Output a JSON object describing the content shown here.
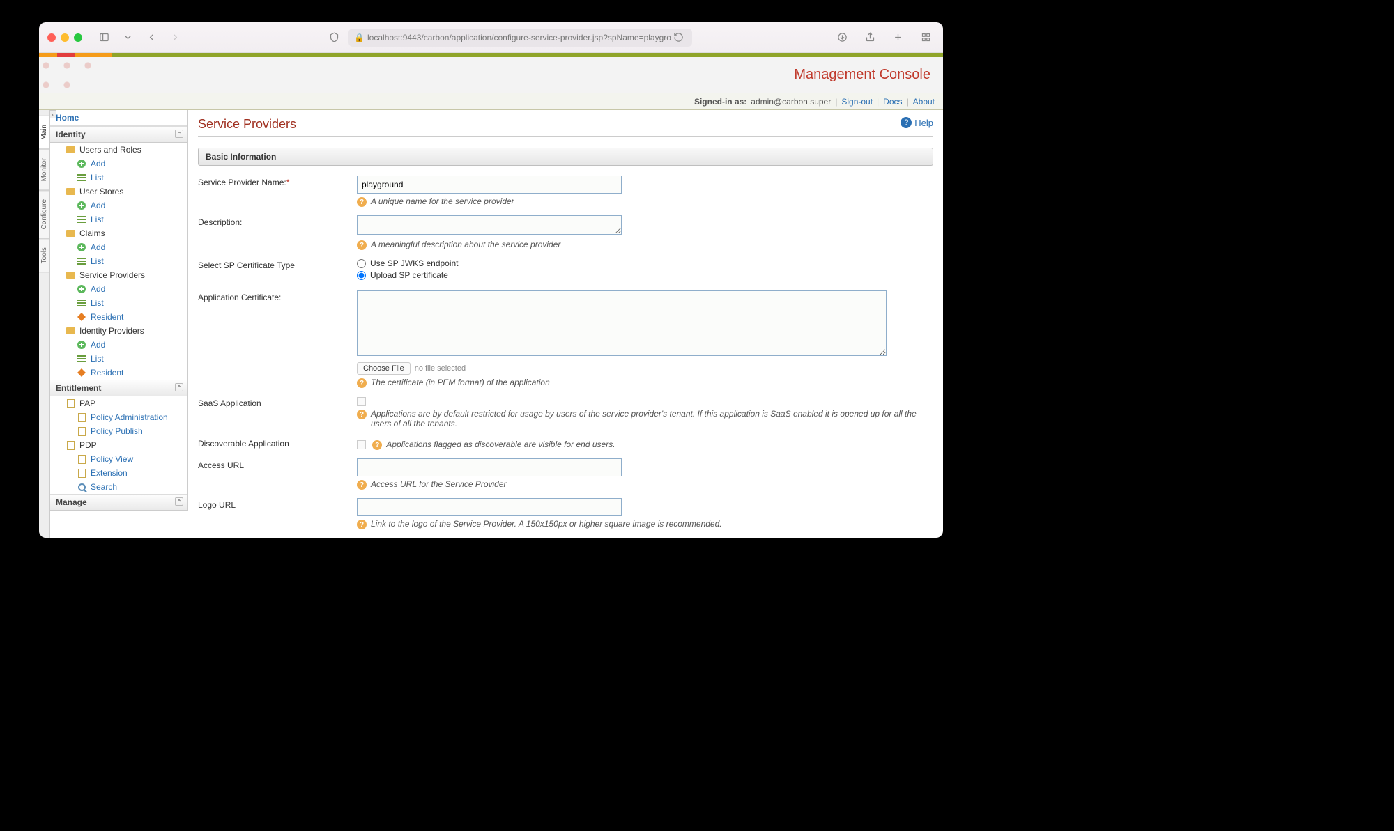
{
  "browser": {
    "url": "localhost:9443/carbon/application/configure-service-provider.jsp?spName=playgro"
  },
  "header": {
    "title": "Management Console"
  },
  "userbar": {
    "signed_in_label": "Signed-in as:",
    "user": "admin@carbon.super",
    "signout": "Sign-out",
    "docs": "Docs",
    "about": "About"
  },
  "side_tabs": [
    "Main",
    "Monitor",
    "Configure",
    "Tools"
  ],
  "sidebar": {
    "home": "Home",
    "sections": {
      "identity": "Identity",
      "entitlement": "Entitlement",
      "manage": "Manage"
    },
    "items": {
      "users_roles": "Users and Roles",
      "user_stores": "User Stores",
      "claims": "Claims",
      "service_providers": "Service Providers",
      "identity_providers": "Identity Providers",
      "pap": "PAP",
      "pdp": "PDP",
      "add": "Add",
      "list": "List",
      "resident": "Resident",
      "policy_admin": "Policy Administration",
      "policy_publish": "Policy Publish",
      "policy_view": "Policy View",
      "extension": "Extension",
      "search": "Search"
    }
  },
  "content": {
    "help": "Help",
    "title": "Service Providers",
    "panel": "Basic Information",
    "labels": {
      "sp_name": "Service Provider Name:",
      "description": "Description:",
      "cert_type": "Select SP Certificate Type",
      "app_cert": "Application Certificate:",
      "saas": "SaaS Application",
      "discoverable": "Discoverable Application",
      "access_url": "Access URL",
      "logo_url": "Logo URL"
    },
    "values": {
      "sp_name": "playground",
      "description": "",
      "access_url": "",
      "logo_url": ""
    },
    "radios": {
      "jwks": "Use SP JWKS endpoint",
      "upload": "Upload SP certificate"
    },
    "file": {
      "button": "Choose File",
      "status": "no file selected"
    },
    "hints": {
      "sp_name": "A unique name for the service provider",
      "description": "A meaningful description about the service provider",
      "app_cert": "The certificate (in PEM format) of the application",
      "saas": "Applications are by default restricted for usage by users of the service provider's tenant. If this application is SaaS enabled it is opened up for all the users of all the tenants.",
      "discoverable": "Applications flagged as discoverable are visible for end users.",
      "access_url": "Access URL for the Service Provider",
      "logo_url": "Link to the logo of the Service Provider. A 150x150px or higher square image is recommended."
    }
  }
}
